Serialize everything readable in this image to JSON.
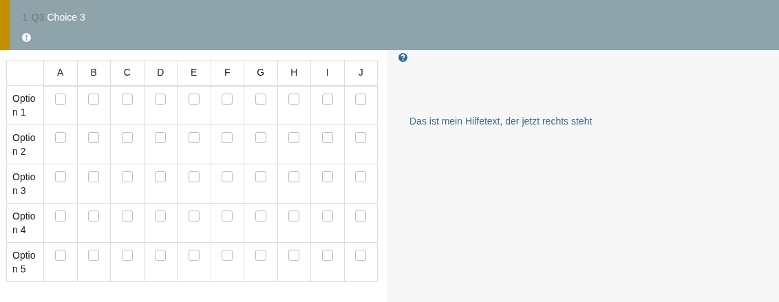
{
  "question": {
    "number": "1",
    "code": "Q3",
    "title": "Choice 3"
  },
  "table": {
    "columns": [
      "A",
      "B",
      "C",
      "D",
      "E",
      "F",
      "G",
      "H",
      "I",
      "J"
    ],
    "rows": [
      {
        "label": "Option 1",
        "checked": [
          false,
          false,
          false,
          false,
          false,
          false,
          false,
          false,
          false,
          false
        ]
      },
      {
        "label": "Option 2",
        "checked": [
          false,
          false,
          false,
          false,
          false,
          false,
          false,
          false,
          false,
          false
        ]
      },
      {
        "label": "Option 3",
        "checked": [
          false,
          false,
          false,
          false,
          false,
          false,
          false,
          false,
          false,
          false
        ]
      },
      {
        "label": "Option 4",
        "checked": [
          false,
          false,
          false,
          false,
          false,
          false,
          false,
          false,
          false,
          false
        ]
      },
      {
        "label": "Option 5",
        "checked": [
          false,
          false,
          false,
          false,
          false,
          false,
          false,
          false,
          false,
          false
        ]
      }
    ]
  },
  "help": {
    "text": "Das ist mein Hilfetext, der jetzt rechts steht"
  }
}
